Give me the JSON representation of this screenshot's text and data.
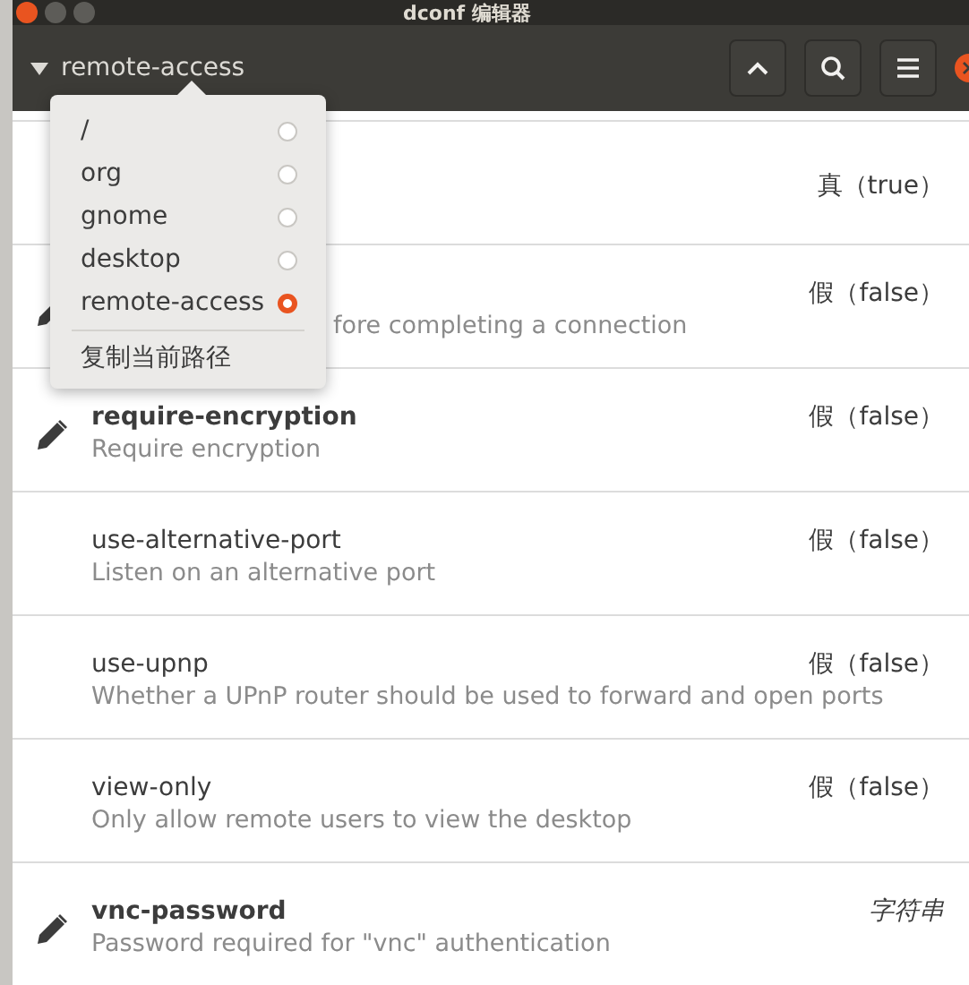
{
  "window": {
    "title": "dconf 编辑器"
  },
  "header": {
    "path": "remote-access"
  },
  "path_menu": {
    "items": [
      {
        "label": "/",
        "selected": false
      },
      {
        "label": "org",
        "selected": false
      },
      {
        "label": "gnome",
        "selected": false
      },
      {
        "label": "desktop",
        "selected": false
      },
      {
        "label": "remote-access",
        "selected": true
      }
    ],
    "action": "复制当前路径"
  },
  "keys": [
    {
      "value": "真（true）",
      "modified": false,
      "kind": "value"
    },
    {
      "description": "fore completing a connection",
      "value": "假（false）",
      "modified": true,
      "kind": "value"
    },
    {
      "name": "require-encryption",
      "description": "Require encryption",
      "value": "假（false）",
      "modified": true,
      "kind": "value"
    },
    {
      "name": "use-alternative-port",
      "description": "Listen on an alternative port",
      "value": "假（false）",
      "modified": false,
      "kind": "value"
    },
    {
      "name": "use-upnp",
      "description": "Whether a UPnP router should be used to forward and open ports",
      "value": "假（false）",
      "modified": false,
      "kind": "value"
    },
    {
      "name": "view-only",
      "description": "Only allow remote users to view the desktop",
      "value": "假（false）",
      "modified": false,
      "kind": "value"
    },
    {
      "name": "vnc-password",
      "description": "Password required for \"vnc\" authentication",
      "value": "字符串",
      "modified": true,
      "kind": "type"
    }
  ]
}
